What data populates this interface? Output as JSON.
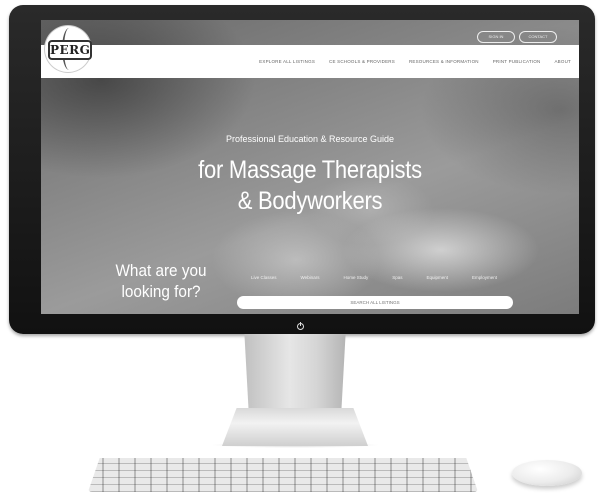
{
  "site": {
    "logo_text": "PERG"
  },
  "header": {
    "buttons": [
      "SIGN IN",
      "CONTACT"
    ],
    "nav": [
      "EXPLORE ALL LISTINGS",
      "CE SCHOOLS & PROVIDERS",
      "RESOURCES & INFORMATION",
      "PRINT PUBLICATION",
      "ABOUT"
    ]
  },
  "hero": {
    "subtitle": "Professional Education & Resource Guide",
    "title_line1": "for Massage Therapists",
    "title_line2": "& Bodyworkers"
  },
  "search_section": {
    "heading_line1": "What are you",
    "heading_line2": "looking for?",
    "categories": [
      "Live Classes",
      "Webinars",
      "Home Study",
      "Spas",
      "Equipment",
      "Employment"
    ],
    "placeholder": "SEARCH ALL LISTINGS"
  },
  "icons": {
    "power": "power-icon",
    "logo_emblem": "caduceus-icon"
  }
}
